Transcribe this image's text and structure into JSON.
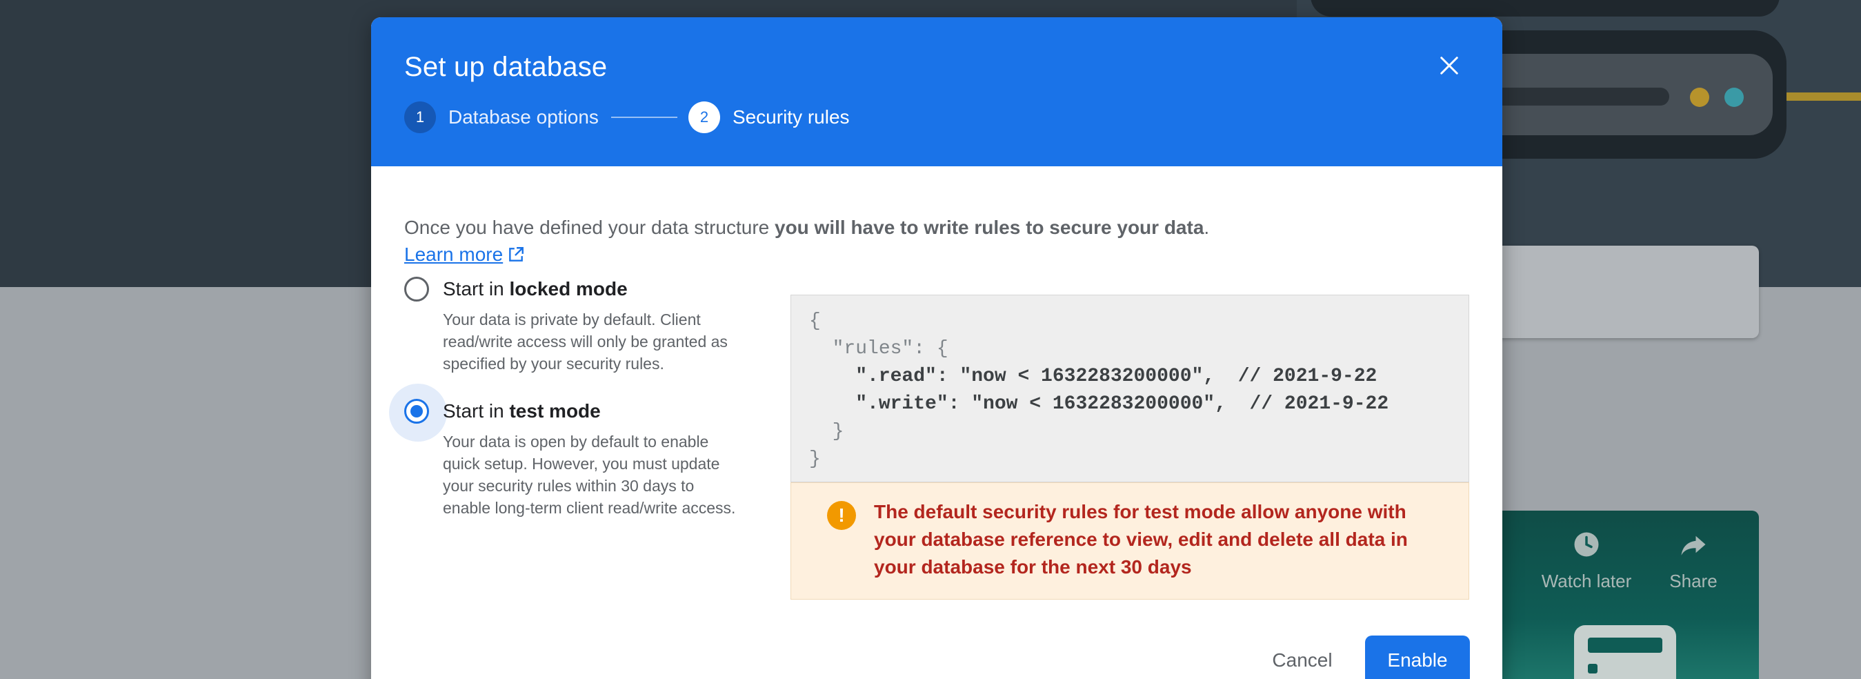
{
  "background": {
    "video_actions": [
      {
        "label": "Watch later",
        "icon": "clock-icon"
      },
      {
        "label": "Share",
        "icon": "share-arrow-icon"
      }
    ]
  },
  "dialog": {
    "title": "Set up database",
    "close_icon": "close-icon",
    "steps": [
      {
        "number": "1",
        "label": "Database options",
        "state": "completed"
      },
      {
        "number": "2",
        "label": "Security rules",
        "state": "active"
      }
    ],
    "intro": {
      "text": "Once you have defined your data structure ",
      "bold": "you will have to write rules to secure your data",
      "suffix": "."
    },
    "learn_more": "Learn more",
    "options": [
      {
        "title_prefix": "Start in ",
        "title_bold": "locked mode",
        "description": "Your data is private by default. Client read/write access will only be granted as specified by your security rules.",
        "selected": false
      },
      {
        "title_prefix": "Start in ",
        "title_bold": "test mode",
        "description": "Your data is open by default to enable quick setup. However, you must update your security rules within 30 days to enable long-term client read/write access.",
        "selected": true
      }
    ],
    "code_lines": [
      "{",
      "  \"rules\": {",
      "    \".read\": \"now < 1632283200000\",  // 2021-9-22",
      "    \".write\": \"now < 1632283200000\",  // 2021-9-22",
      "  }",
      "}"
    ],
    "warning": "The default security rules for test mode allow anyone with your database reference to view, edit and delete all data in your database for the next 30 days",
    "buttons": {
      "cancel": "Cancel",
      "enable": "Enable"
    },
    "colors": {
      "header": "#1a73e8",
      "warning_text": "#b3261e",
      "warning_bg": "#fef0de",
      "warning_icon": "#f29900"
    }
  }
}
